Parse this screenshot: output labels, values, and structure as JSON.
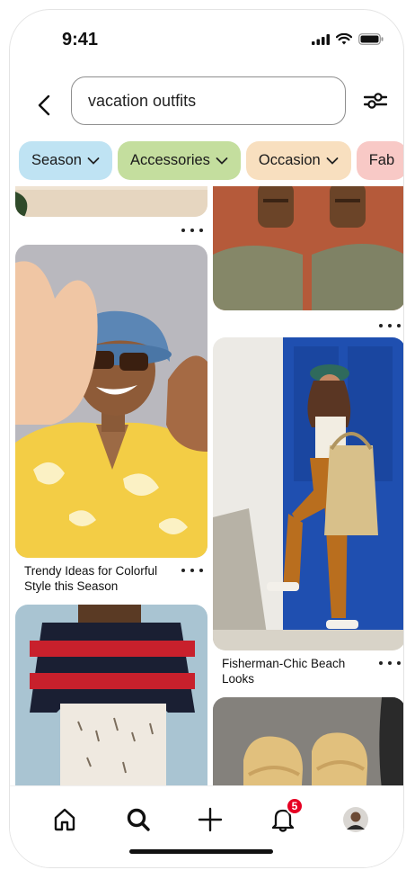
{
  "status_bar": {
    "time": "9:41"
  },
  "search": {
    "query": "vacation outfits"
  },
  "chips": [
    {
      "label": "Season",
      "color": "#bfe3f3"
    },
    {
      "label": "Accessories",
      "color": "#c4de9e"
    },
    {
      "label": "Occasion",
      "color": "#f8dfbf"
    },
    {
      "label": "Fab",
      "color": "#f8c9c6"
    }
  ],
  "pins": [
    {
      "title": "Trendy Ideas for Colorful Style this Season"
    },
    {
      "title": "Fisherman-Chic Beach Looks"
    }
  ],
  "nav": {
    "notification_count": "5"
  },
  "colors": {
    "accent": "#e60023"
  }
}
